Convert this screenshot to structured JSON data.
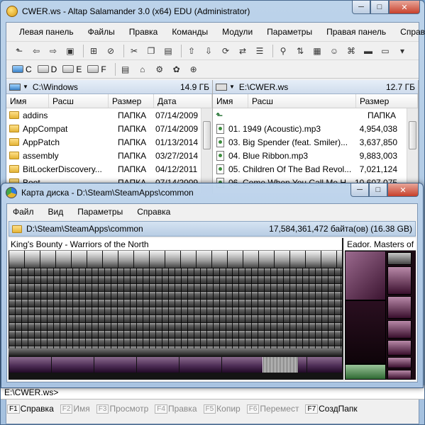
{
  "window": {
    "title": "CWER.ws - Altap Salamander 3.0 (x64) EDU (Administrator)",
    "caption": {
      "minimize": "─",
      "maximize": "□",
      "close": "✕"
    }
  },
  "menu": [
    "Левая панель",
    "Файлы",
    "Правка",
    "Команды",
    "Модули",
    "Параметры",
    "Правая панель",
    "Справка"
  ],
  "toolbar_icons": [
    "parent-dir-icon",
    "back-icon",
    "forward-icon",
    "filter-icon",
    "select-icon",
    "unselect-icon",
    "cut-icon",
    "copy-icon",
    "paste-icon",
    "up-icon",
    "down-icon",
    "refresh-icon",
    "compare-icon",
    "tree-icon",
    "find-icon",
    "sort-icon",
    "zip-icon",
    "user-icon",
    "network-icon",
    "cmd-icon",
    "view-icon",
    "more-icon"
  ],
  "drives": [
    {
      "letter": "C",
      "system": true
    },
    {
      "letter": "D",
      "system": false
    },
    {
      "letter": "E",
      "system": false
    },
    {
      "letter": "F",
      "system": false
    }
  ],
  "left_panel": {
    "path": "C:\\Windows",
    "free": "14.9 ГБ",
    "columns": [
      "Имя",
      "Расш",
      "Размер",
      "Дата"
    ],
    "rows": [
      {
        "name": "addins",
        "size": "ПАПКА",
        "date": "07/14/2009"
      },
      {
        "name": "AppCompat",
        "size": "ПАПКА",
        "date": "07/14/2009"
      },
      {
        "name": "AppPatch",
        "size": "ПАПКА",
        "date": "01/13/2014"
      },
      {
        "name": "assembly",
        "size": "ПАПКА",
        "date": "03/27/2014"
      },
      {
        "name": "BitLockerDiscovery...",
        "size": "ПАПКА",
        "date": "04/12/2011"
      },
      {
        "name": "Boot",
        "size": "ПАПКА",
        "date": "07/14/2009"
      }
    ]
  },
  "right_panel": {
    "path": "E:\\CWER.ws",
    "free": "12.7 ГБ",
    "columns": [
      "Имя",
      "Расш",
      "Размер"
    ],
    "up_size": "ПАПКА",
    "rows": [
      {
        "name": "01. 1949 (Acoustic).mp3",
        "size": "4,954,038"
      },
      {
        "name": "03. Big Spender (feat. Smiler)...",
        "size": "3,637,850"
      },
      {
        "name": "04. Blue Ribbon.mp3",
        "size": "9,883,003"
      },
      {
        "name": "05. Children Of The Bad Revol...",
        "size": "7,021,124"
      },
      {
        "name": "06. Come When You Call Me H...",
        "size": "10,607,075"
      }
    ]
  },
  "disk_map": {
    "title": "Карта диска - D:\\Steam\\SteamApps\\common",
    "menu": [
      "Файл",
      "Вид",
      "Параметры",
      "Справка"
    ],
    "path": "D:\\Steam\\SteamApps\\common",
    "size": "17,584,361,472 байта(ов) (16.38 GB)",
    "zones": [
      "King's Bounty - Warriors of the North",
      "Eador. Masters of t"
    ]
  },
  "cmdline": "E:\\CWER.ws>",
  "fkeys": [
    {
      "key": "F1",
      "label": "Справка",
      "active": true
    },
    {
      "key": "F2",
      "label": "Имя",
      "active": false
    },
    {
      "key": "F3",
      "label": "Просмотр",
      "active": false
    },
    {
      "key": "F4",
      "label": "Правка",
      "active": false
    },
    {
      "key": "F5",
      "label": "Копир",
      "active": false
    },
    {
      "key": "F6",
      "label": "Перемест",
      "active": false
    },
    {
      "key": "F7",
      "label": "СоздПапк",
      "active": true
    }
  ]
}
